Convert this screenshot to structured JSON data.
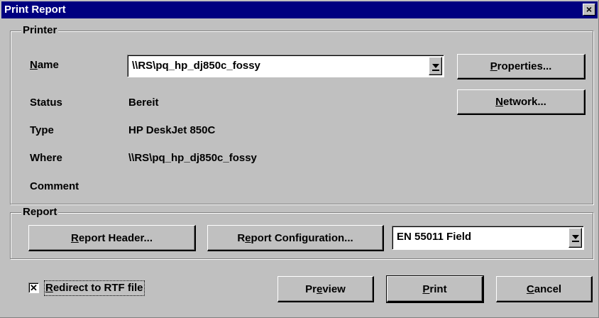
{
  "window": {
    "title": "Print Report",
    "close_label": "×"
  },
  "printer": {
    "group_label": "Printer",
    "name_label": {
      "mnemonic": "N",
      "rest": "ame"
    },
    "name_value": "\\\\RS\\pq_hp_dj850c_fossy",
    "status_label": "Status",
    "status_value": "Bereit",
    "type_label": "Type",
    "type_value": "HP DeskJet 850C",
    "where_label": "Where",
    "where_value": "\\\\RS\\pq_hp_dj850c_fossy",
    "comment_label": "Comment",
    "comment_value": "",
    "properties_button": {
      "mnemonic": "P",
      "rest": "roperties..."
    },
    "network_button": {
      "mnemonic": "N",
      "rest": "etwork..."
    }
  },
  "report": {
    "group_label": "Report",
    "header_button": {
      "mnemonic": "R",
      "rest": "eport Header..."
    },
    "config_button": {
      "pre": "R",
      "mnemonic": "e",
      "rest": "port Configuration..."
    },
    "type_value": "EN 55011 Field"
  },
  "footer": {
    "redirect_checkbox": {
      "checked_mark": "✕",
      "mnemonic": "R",
      "rest": "edirect to RTF file"
    },
    "preview_button": {
      "pre": "Pr",
      "mnemonic": "e",
      "rest": "view"
    },
    "print_button": {
      "mnemonic": "P",
      "rest": "rint"
    },
    "cancel_button": {
      "mnemonic": "C",
      "rest": "ancel"
    }
  },
  "colors": {
    "face": "#c0c0c0",
    "titlebar": "#000080",
    "shadow": "#808080",
    "highlight": "#ffffff"
  }
}
